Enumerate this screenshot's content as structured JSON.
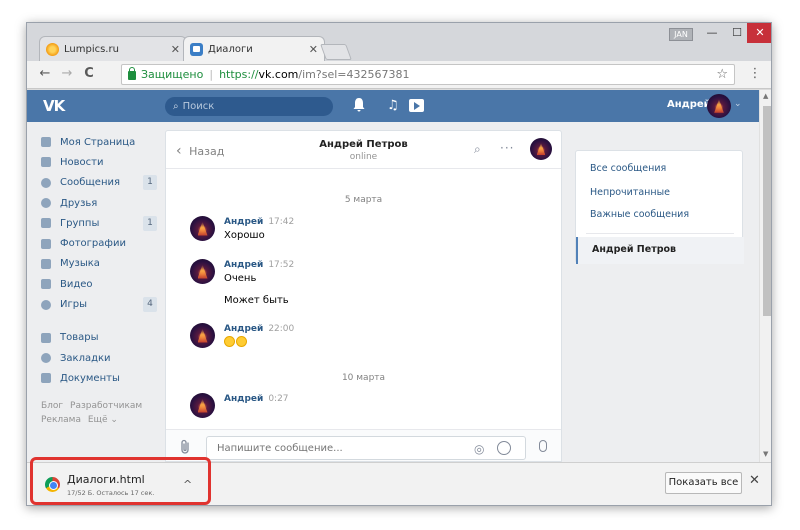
{
  "browser": {
    "tabs": [
      {
        "title": "Lumpics.ru",
        "close": "✕"
      },
      {
        "title": "Диалоги",
        "close": "✕"
      }
    ],
    "profile_badge": "JAN",
    "window_controls": {
      "minimize": "—",
      "maximize": "☐",
      "close": "✕"
    },
    "nav": {
      "back": "←",
      "forward": "→",
      "reload": "C"
    },
    "address": {
      "secure_label": "Защищено",
      "separator": "|",
      "scheme": "https://",
      "host": "vk.com",
      "path": "/im?sel=432567381"
    },
    "bookmark_icon": "☆",
    "menu_icon": "⋮"
  },
  "vk_header": {
    "logo": "VK",
    "search_placeholder": "Поиск",
    "search_icon": "⌕",
    "bell_icon": "🔔",
    "music_icon": "♫",
    "user_name": "Андрей",
    "caret": "⌄"
  },
  "left_menu": {
    "items": [
      {
        "label": "Моя Страница",
        "count": ""
      },
      {
        "label": "Новости",
        "count": ""
      },
      {
        "label": "Сообщения",
        "count": "1"
      },
      {
        "label": "Друзья",
        "count": ""
      },
      {
        "label": "Группы",
        "count": "1"
      },
      {
        "label": "Фотографии",
        "count": ""
      },
      {
        "label": "Музыка",
        "count": ""
      },
      {
        "label": "Видео",
        "count": ""
      },
      {
        "label": "Игры",
        "count": "4"
      }
    ],
    "items2": [
      {
        "label": "Товары"
      },
      {
        "label": "Закладки"
      },
      {
        "label": "Документы"
      }
    ],
    "footer": {
      "blog": "Блог",
      "developers": "Разработчикам",
      "ads": "Реклама",
      "more": "Ещё ⌄"
    }
  },
  "chat": {
    "back_label": "Назад",
    "back_icon": "‹",
    "title": "Андрей Петров",
    "status": "online",
    "search_icon": "⌕",
    "more_icon": "···",
    "dates": [
      "5 марта",
      "10 марта"
    ],
    "messages": [
      {
        "author": "Андрей",
        "time": "17:42",
        "text": "Хорошо"
      },
      {
        "author": "Андрей",
        "time": "17:52",
        "text": "Очень"
      },
      {
        "author": "",
        "time": "",
        "text": "Может быть"
      },
      {
        "author": "Андрей",
        "time": "22:00",
        "text": ""
      },
      {
        "author": "Андрей",
        "time": "0:27",
        "text": ""
      }
    ],
    "composer_placeholder": "Напишите сообщение...",
    "clip_icon": "⌇",
    "camera_icon": "◎"
  },
  "right_panel": {
    "items": [
      "Все сообщения",
      "Непрочитанные",
      "Важные сообщения"
    ],
    "active": "Андрей Петров"
  },
  "download_bar": {
    "file_name": "Диалоги.html",
    "status": "17/52 Б. Осталось 17 сек.",
    "caret": "^",
    "show_all": "Показать все",
    "close": "✕"
  },
  "colors": {
    "vk_blue": "#4a76a8",
    "link": "#2a5885",
    "highlight": "#e0332f"
  }
}
